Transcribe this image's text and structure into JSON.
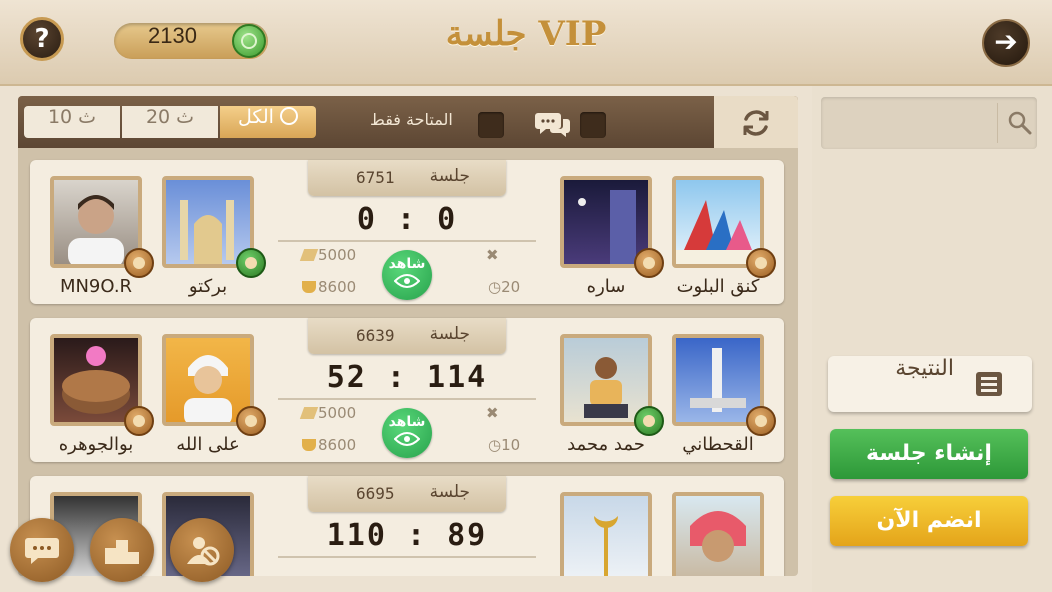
{
  "header": {
    "title": "جلسة VIP",
    "coins": "2130",
    "help_icon": "question-icon",
    "back_icon": "arrow-right-icon"
  },
  "filters": {
    "tabs": [
      {
        "label": "10 ث",
        "active": false
      },
      {
        "label": "20 ث",
        "active": false
      },
      {
        "label": "الكل",
        "active": true
      }
    ],
    "available_only": "المتاحة فقط"
  },
  "search": {
    "placeholder": ""
  },
  "sidebar": {
    "results_label": "النتيجة",
    "create_label": "إنشاء جلسة",
    "join_label": "انضم الآن"
  },
  "sessions": [
    {
      "session_label": "جلسة",
      "id": "6751",
      "score": "0 : 0",
      "bet": "5000",
      "cup": "8600",
      "time": "20",
      "watch": "شاهد",
      "players": [
        "MN9O.R",
        "بركتو",
        "ساره",
        "كنق البلوت"
      ]
    },
    {
      "session_label": "جلسة",
      "id": "6639",
      "score": "52 : 114",
      "bet": "5000",
      "cup": "8600",
      "time": "10",
      "watch": "شاهد",
      "players": [
        "بوالجوهره",
        "على الله",
        "حمد محمد",
        "القحطاني"
      ]
    },
    {
      "session_label": "جلسة",
      "id": "6695",
      "score": "110 : 89",
      "bet": "",
      "cup": "",
      "time": "",
      "watch": "",
      "players": [
        "",
        "",
        "",
        ""
      ]
    }
  ],
  "colors": {
    "title_gold": "#c4903a",
    "create_green": "#2d9838",
    "join_yellow": "#e4a41a",
    "watch_green": "#27a24c"
  }
}
